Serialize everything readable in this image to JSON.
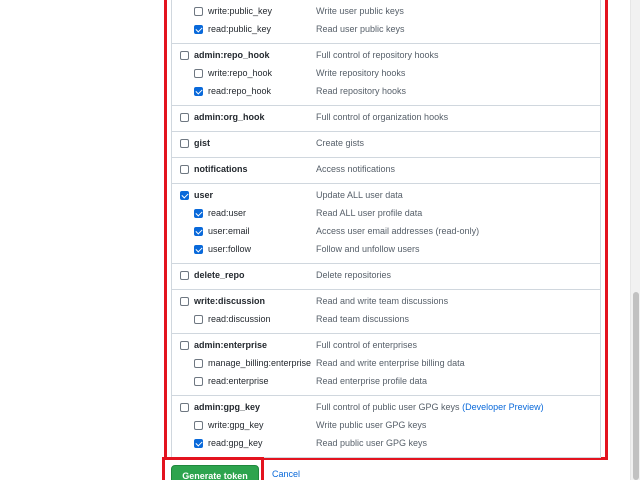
{
  "scopes": [
    {
      "name": "write:public_key",
      "desc": "Write user public keys",
      "checked": false,
      "level": "child",
      "group_start": true
    },
    {
      "name": "read:public_key",
      "desc": "Read user public keys",
      "checked": true,
      "level": "child"
    },
    {
      "name": "admin:repo_hook",
      "desc": "Full control of repository hooks",
      "checked": false,
      "level": "parent",
      "group_start": true
    },
    {
      "name": "write:repo_hook",
      "desc": "Write repository hooks",
      "checked": false,
      "level": "child"
    },
    {
      "name": "read:repo_hook",
      "desc": "Read repository hooks",
      "checked": true,
      "level": "child"
    },
    {
      "name": "admin:org_hook",
      "desc": "Full control of organization hooks",
      "checked": false,
      "level": "parent",
      "group_start": true
    },
    {
      "name": "gist",
      "desc": "Create gists",
      "checked": false,
      "level": "parent",
      "group_start": true
    },
    {
      "name": "notifications",
      "desc": "Access notifications",
      "checked": false,
      "level": "parent",
      "group_start": true
    },
    {
      "name": "user",
      "desc": "Update ALL user data",
      "checked": true,
      "level": "parent",
      "group_start": true
    },
    {
      "name": "read:user",
      "desc": "Read ALL user profile data",
      "checked": true,
      "level": "child"
    },
    {
      "name": "user:email",
      "desc": "Access user email addresses (read-only)",
      "checked": true,
      "level": "child"
    },
    {
      "name": "user:follow",
      "desc": "Follow and unfollow users",
      "checked": true,
      "level": "child"
    },
    {
      "name": "delete_repo",
      "desc": "Delete repositories",
      "checked": false,
      "level": "parent",
      "group_start": true
    },
    {
      "name": "write:discussion",
      "desc": "Read and write team discussions",
      "checked": false,
      "level": "parent",
      "group_start": true
    },
    {
      "name": "read:discussion",
      "desc": "Read team discussions",
      "checked": false,
      "level": "child"
    },
    {
      "name": "admin:enterprise",
      "desc": "Full control of enterprises",
      "checked": false,
      "level": "parent",
      "group_start": true
    },
    {
      "name": "manage_billing:enterprise",
      "desc": "Read and write enterprise billing data",
      "checked": false,
      "level": "child"
    },
    {
      "name": "read:enterprise",
      "desc": "Read enterprise profile data",
      "checked": false,
      "level": "child"
    },
    {
      "name": "admin:gpg_key",
      "desc": "Full control of public user GPG keys",
      "desc_link": "(Developer Preview)",
      "checked": false,
      "level": "parent",
      "group_start": true
    },
    {
      "name": "write:gpg_key",
      "desc": "Write public user GPG keys",
      "checked": false,
      "level": "child"
    },
    {
      "name": "read:gpg_key",
      "desc": "Read public user GPG keys",
      "checked": true,
      "level": "child"
    }
  ],
  "actions": {
    "generate_label": "Generate token",
    "cancel_label": "Cancel"
  },
  "colors": {
    "highlight": "#e3131f",
    "primary_button": "#2da44e",
    "checkbox_checked": "#0969da",
    "link": "#0969da"
  }
}
